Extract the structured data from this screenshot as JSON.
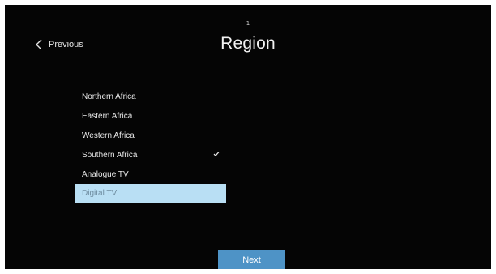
{
  "header": {
    "step": "1",
    "title": "Region",
    "previous_label": "Previous"
  },
  "list": {
    "items": [
      {
        "label": "Northern Africa",
        "checked": false,
        "selected": false
      },
      {
        "label": "Eastern Africa",
        "checked": false,
        "selected": false
      },
      {
        "label": "Western Africa",
        "checked": false,
        "selected": false
      },
      {
        "label": "Southern Africa",
        "checked": true,
        "selected": false
      },
      {
        "label": "Analogue TV",
        "checked": false,
        "selected": false
      },
      {
        "label": "Digital TV",
        "checked": false,
        "selected": true
      }
    ]
  },
  "footer": {
    "next_label": "Next"
  },
  "colors": {
    "background": "#050505",
    "selection": "#b9dff4",
    "button": "#4e93c6"
  },
  "icons": {
    "previous": "chevron-left-icon",
    "check": "checkmark-icon"
  }
}
